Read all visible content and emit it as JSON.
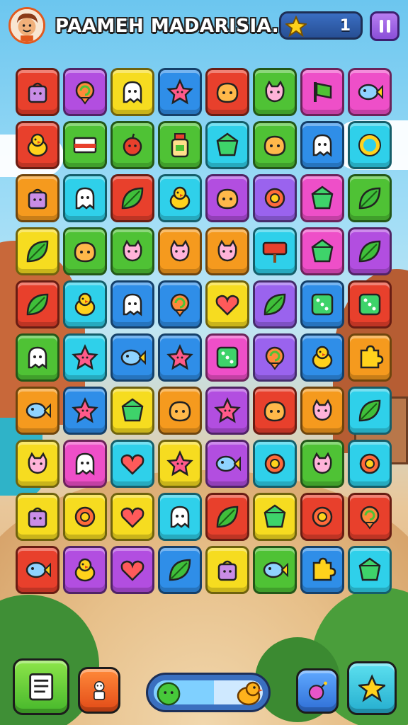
{
  "header": {
    "title": "PAAMEH MADARISIA.",
    "score": "1",
    "avatar_icon": "face-avatar-icon",
    "score_icon": "star-icon",
    "pause_icon": "pause-icon"
  },
  "board": {
    "columns": 8,
    "rows": 10,
    "palette": {
      "red": "#e8402c",
      "purple": "#b24ee0",
      "yellow": "#f6dc20",
      "blue": "#2f8ee8",
      "orange": "#f59a1e",
      "green": "#4fc235",
      "pink": "#ee4fc8",
      "cyan": "#2fd0ea",
      "violet": "#9a63ee",
      "lime": "#8fd33a"
    },
    "tiles": [
      [
        {
          "c": "red",
          "i": "bag"
        },
        {
          "c": "purple",
          "i": "swirl"
        },
        {
          "c": "yellow",
          "i": "ghost"
        },
        {
          "c": "blue",
          "i": "star"
        },
        {
          "c": "red",
          "i": "blob"
        },
        {
          "c": "green",
          "i": "cat"
        },
        {
          "c": "pink",
          "i": "flag"
        },
        {
          "c": "pink",
          "i": "fish"
        }
      ],
      [
        {
          "c": "red",
          "i": "chick"
        },
        {
          "c": "green",
          "i": "card"
        },
        {
          "c": "green",
          "i": "apple"
        },
        {
          "c": "green",
          "i": "bottle"
        },
        {
          "c": "cyan",
          "i": "gem"
        },
        {
          "c": "green",
          "i": "blob"
        },
        {
          "c": "blue",
          "i": "ghost"
        },
        {
          "c": "cyan",
          "i": "ring"
        }
      ],
      [
        {
          "c": "orange",
          "i": "bag"
        },
        {
          "c": "cyan",
          "i": "ghost"
        },
        {
          "c": "red",
          "i": "leaf"
        },
        {
          "c": "cyan",
          "i": "chick"
        },
        {
          "c": "purple",
          "i": "blob"
        },
        {
          "c": "violet",
          "i": "flower"
        },
        {
          "c": "pink",
          "i": "gem"
        },
        {
          "c": "green",
          "i": "leaf"
        }
      ],
      [
        {
          "c": "yellow",
          "i": "leaf"
        },
        {
          "c": "green",
          "i": "blob"
        },
        {
          "c": "green",
          "i": "cat"
        },
        {
          "c": "orange",
          "i": "cat"
        },
        {
          "c": "orange",
          "i": "cat"
        },
        {
          "c": "cyan",
          "i": "sign"
        },
        {
          "c": "pink",
          "i": "gem"
        },
        {
          "c": "purple",
          "i": "leaf"
        }
      ],
      [
        {
          "c": "red",
          "i": "leaf"
        },
        {
          "c": "cyan",
          "i": "chick"
        },
        {
          "c": "blue",
          "i": "ghost"
        },
        {
          "c": "blue",
          "i": "swirl"
        },
        {
          "c": "yellow",
          "i": "heart"
        },
        {
          "c": "violet",
          "i": "leaf"
        },
        {
          "c": "blue",
          "i": "dice"
        },
        {
          "c": "red",
          "i": "dice"
        }
      ],
      [
        {
          "c": "green",
          "i": "ghost"
        },
        {
          "c": "cyan",
          "i": "star"
        },
        {
          "c": "blue",
          "i": "fish"
        },
        {
          "c": "blue",
          "i": "star"
        },
        {
          "c": "pink",
          "i": "dice"
        },
        {
          "c": "violet",
          "i": "swirl"
        },
        {
          "c": "blue",
          "i": "chick"
        },
        {
          "c": "orange",
          "i": "puzzle"
        }
      ],
      [
        {
          "c": "orange",
          "i": "fish"
        },
        {
          "c": "blue",
          "i": "star"
        },
        {
          "c": "yellow",
          "i": "gem"
        },
        {
          "c": "orange",
          "i": "blob"
        },
        {
          "c": "purple",
          "i": "star"
        },
        {
          "c": "red",
          "i": "blob"
        },
        {
          "c": "orange",
          "i": "cat"
        },
        {
          "c": "cyan",
          "i": "leaf"
        }
      ],
      [
        {
          "c": "yellow",
          "i": "cat"
        },
        {
          "c": "pink",
          "i": "ghost"
        },
        {
          "c": "cyan",
          "i": "heart"
        },
        {
          "c": "yellow",
          "i": "star"
        },
        {
          "c": "purple",
          "i": "fish"
        },
        {
          "c": "cyan",
          "i": "flower"
        },
        {
          "c": "green",
          "i": "cat"
        },
        {
          "c": "cyan",
          "i": "flower"
        }
      ],
      [
        {
          "c": "yellow",
          "i": "bag"
        },
        {
          "c": "yellow",
          "i": "flower"
        },
        {
          "c": "yellow",
          "i": "heart"
        },
        {
          "c": "cyan",
          "i": "ghost"
        },
        {
          "c": "red",
          "i": "leaf"
        },
        {
          "c": "yellow",
          "i": "gem"
        },
        {
          "c": "red",
          "i": "flower"
        },
        {
          "c": "red",
          "i": "swirl"
        }
      ],
      [
        {
          "c": "red",
          "i": "fish"
        },
        {
          "c": "purple",
          "i": "chick"
        },
        {
          "c": "purple",
          "i": "heart"
        },
        {
          "c": "blue",
          "i": "leaf"
        },
        {
          "c": "yellow",
          "i": "bag"
        },
        {
          "c": "green",
          "i": "fish"
        },
        {
          "c": "blue",
          "i": "puzzle"
        },
        {
          "c": "cyan",
          "i": "gem"
        }
      ]
    ]
  },
  "bottom_bar": {
    "menu_icon": "list-icon",
    "character_icon": "character-icon",
    "progress_fraction": 0.55,
    "progress_start_icon": "slime-icon",
    "progress_end_icon": "chick-icon",
    "booster_icon": "bomb-icon",
    "star_icon": "star-icon"
  }
}
